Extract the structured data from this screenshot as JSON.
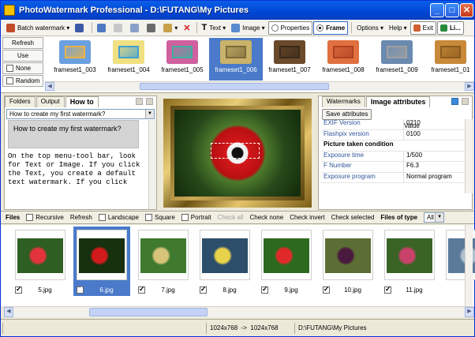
{
  "window": {
    "title": "PhotoWatermark Professional - D:\\FUTANG\\My Pictures"
  },
  "toolbar": {
    "batch_label": "Batch watermark",
    "text_label": "Text",
    "image_label": "Image",
    "properties_label": "Properties",
    "frame_label": "Frame",
    "options_label": "Options",
    "help_label": "Help",
    "exit_label": "Exit",
    "li_label": "Li..."
  },
  "framestrip": {
    "buttons": [
      "Refresh",
      "Use",
      "None",
      "Random"
    ],
    "items": [
      {
        "label": "frameset1_003",
        "c1": "#6aa0e0",
        "c2": "#e8b34a"
      },
      {
        "label": "frameset1_004",
        "c1": "#f0e080",
        "c2": "#44a0d0"
      },
      {
        "label": "frameset1_005",
        "c1": "#d060a0",
        "c2": "#40b0a0"
      },
      {
        "label": "frameset1_006",
        "c1": "#c9b26a",
        "c2": "#7c6a3a"
      },
      {
        "label": "frameset1_007",
        "c1": "#6a4a2a",
        "c2": "#3a2a1a"
      },
      {
        "label": "frameset1_008",
        "c1": "#e07040",
        "c2": "#b04020"
      },
      {
        "label": "frameset1_009",
        "c1": "#6a8ab0",
        "c2": "#a0a0a0"
      },
      {
        "label": "frameset1_01",
        "c1": "#c88a3a",
        "c2": "#8a5a1a"
      }
    ],
    "selected_index": 3
  },
  "leftpanel": {
    "tabs": [
      "Folders",
      "Output",
      "How to"
    ],
    "combo": "How to create my first watermark?",
    "question": "How to create my first watermark?",
    "body": "On the top menu-tool bar, look for Text or Image. If you click the Text, you create a default text watermark. If you click"
  },
  "rightpanel": {
    "tabs": [
      "Watermarks",
      "Image attributes"
    ],
    "save_label": "Save attributes",
    "value_header": "Value",
    "rows": [
      {
        "k": "EXIF Version",
        "v": "0210"
      },
      {
        "k": "Flashpix version",
        "v": "0100"
      },
      {
        "section": "Picture taken condition"
      },
      {
        "k": "Exposure time",
        "v": "1/500"
      },
      {
        "k": "F Number",
        "v": "F6.3"
      },
      {
        "k": "Exposure program",
        "v": "Normal program"
      }
    ]
  },
  "filesbar": {
    "files": "Files",
    "recursive": "Recursive",
    "refresh": "Refresh",
    "landscape": "Landscape",
    "square": "Square",
    "portrait": "Portrait",
    "check_all": "Check all",
    "check_none": "Check none",
    "check_invert": "Check invert",
    "check_selected": "Check selected",
    "files_of_type": "Files of type",
    "type_value": "All"
  },
  "thumbs": {
    "items": [
      {
        "name": "5.jpg",
        "bg": "#2f5e22",
        "fg": "#e2343a"
      },
      {
        "name": "6.jpg",
        "bg": "#17300e",
        "fg": "#d11a1c"
      },
      {
        "name": "7.jpg",
        "bg": "#3f7a2e",
        "fg": "#d8c37a"
      },
      {
        "name": "8.jpg",
        "bg": "#2c4e6a",
        "fg": "#e8d24a"
      },
      {
        "name": "9.jpg",
        "bg": "#2d6a20",
        "fg": "#e02a2a"
      },
      {
        "name": "10.jpg",
        "bg": "#5b6e34",
        "fg": "#4a1a3e"
      },
      {
        "name": "11.jpg",
        "bg": "#3a6426",
        "fg": "#c8426a"
      },
      {
        "name": "",
        "bg": "#5b7a9a",
        "fg": "#b0c0d0"
      }
    ],
    "selected_index": 1
  },
  "status": {
    "dims_from": "1024x768",
    "arrow": "->",
    "dims_to": "1024x768",
    "path": "D:\\FUTANG\\My Pictures"
  },
  "colors": {
    "accent": "#4a7ac9",
    "titlebar": "#0046d5"
  }
}
